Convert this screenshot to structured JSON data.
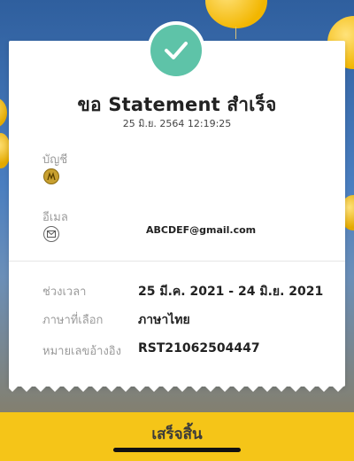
{
  "header": {
    "title": "ขอ Statement สำเร็จ",
    "datetime": "25 มิ.ย. 2564 12:19:25"
  },
  "account": {
    "label": "บัญชี",
    "icon": "bank-logo-icon"
  },
  "email": {
    "label": "อีเมล",
    "value": "ABCDEF@gmail.com",
    "icon": "mail-icon"
  },
  "details": [
    {
      "label": "ช่วงเวลา",
      "value": "25 มี.ค. 2021 - 24 มิ.ย. 2021"
    },
    {
      "label": "ภาษาที่เลือก",
      "value": "ภาษาไทย"
    },
    {
      "label": "หมายเลขอ้างอิง",
      "value": "RST21062504447"
    }
  ],
  "footer": {
    "done_label": "เสร็จสิ้น"
  },
  "colors": {
    "accent_green": "#5ec3a8",
    "bottom_bar": "#f5c518"
  }
}
